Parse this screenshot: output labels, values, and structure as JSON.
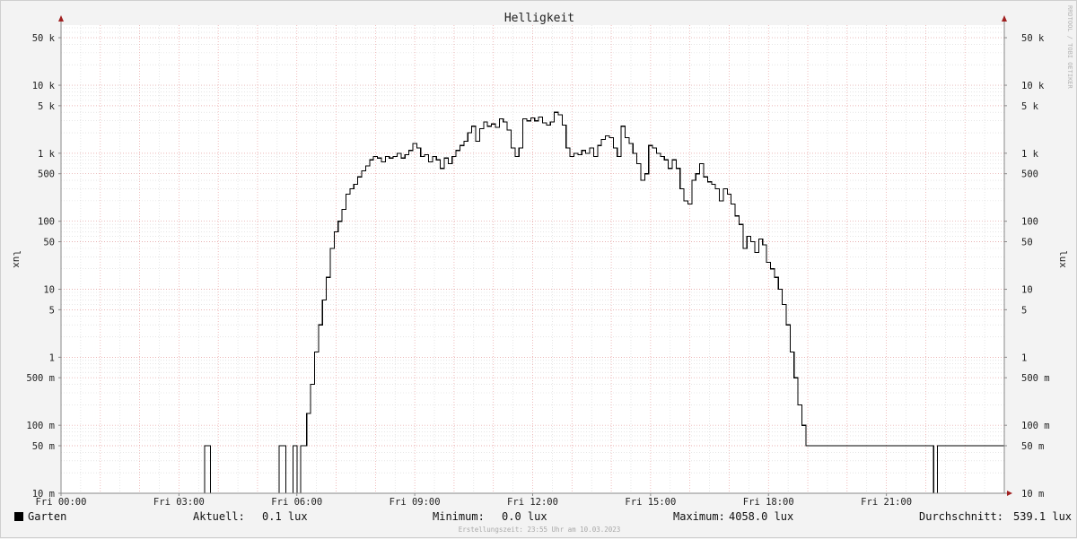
{
  "chart_data": {
    "type": "line",
    "title": "Helligkeit",
    "ylabel": "lux",
    "yscale": "log",
    "ylim": [
      0.01,
      80000
    ],
    "xlim_hours": [
      0,
      24
    ],
    "grid": true,
    "watermark": "RRDTOOL / TOBI OETIKER",
    "x_ticks": [
      {
        "h": 0,
        "label": "Fri 00:00"
      },
      {
        "h": 3,
        "label": "Fri 03:00"
      },
      {
        "h": 6,
        "label": "Fri 06:00"
      },
      {
        "h": 9,
        "label": "Fri 09:00"
      },
      {
        "h": 12,
        "label": "Fri 12:00"
      },
      {
        "h": 15,
        "label": "Fri 15:00"
      },
      {
        "h": 18,
        "label": "Fri 18:00"
      },
      {
        "h": 21,
        "label": "Fri 21:00"
      }
    ],
    "y_ticks": [
      {
        "v": 50000,
        "label": "50 k"
      },
      {
        "v": 10000,
        "label": "10 k"
      },
      {
        "v": 5000,
        "label": "5 k"
      },
      {
        "v": 1000,
        "label": "1 k"
      },
      {
        "v": 500,
        "label": "500"
      },
      {
        "v": 100,
        "label": "100"
      },
      {
        "v": 50,
        "label": "50"
      },
      {
        "v": 10,
        "label": "10"
      },
      {
        "v": 5,
        "label": "5"
      },
      {
        "v": 1,
        "label": "1"
      },
      {
        "v": 0.5,
        "label": "500 m"
      },
      {
        "v": 0.1,
        "label": "100 m"
      },
      {
        "v": 0.05,
        "label": "50 m"
      },
      {
        "v": 0.01,
        "label": "10 m"
      }
    ],
    "series": [
      {
        "name": "Garten",
        "color": "#000000",
        "points": [
          [
            0,
            0.01
          ],
          [
            3.65,
            0.01
          ],
          [
            3.65,
            0.05
          ],
          [
            3.8,
            0.05
          ],
          [
            3.8,
            0.01
          ],
          [
            5.55,
            0.01
          ],
          [
            5.55,
            0.05
          ],
          [
            5.72,
            0.05
          ],
          [
            5.72,
            0.01
          ],
          [
            5.9,
            0.01
          ],
          [
            5.9,
            0.05
          ],
          [
            6.0,
            0.05
          ],
          [
            6.0,
            0.01
          ],
          [
            6.1,
            0.01
          ],
          [
            6.1,
            0.05
          ],
          [
            6.25,
            0.05
          ],
          [
            6.25,
            0.15
          ],
          [
            6.35,
            0.4
          ],
          [
            6.45,
            1.2
          ],
          [
            6.55,
            3
          ],
          [
            6.65,
            7
          ],
          [
            6.75,
            15
          ],
          [
            6.85,
            40
          ],
          [
            6.95,
            70
          ],
          [
            7.05,
            100
          ],
          [
            7.15,
            150
          ],
          [
            7.25,
            250
          ],
          [
            7.35,
            300
          ],
          [
            7.45,
            350
          ],
          [
            7.55,
            450
          ],
          [
            7.65,
            550
          ],
          [
            7.75,
            650
          ],
          [
            7.85,
            800
          ],
          [
            7.95,
            900
          ],
          [
            8.05,
            850
          ],
          [
            8.15,
            750
          ],
          [
            8.25,
            900
          ],
          [
            8.35,
            850
          ],
          [
            8.45,
            900
          ],
          [
            8.55,
            1000
          ],
          [
            8.65,
            850
          ],
          [
            8.75,
            950
          ],
          [
            8.85,
            1100
          ],
          [
            8.95,
            1400
          ],
          [
            9.05,
            1200
          ],
          [
            9.15,
            900
          ],
          [
            9.25,
            950
          ],
          [
            9.35,
            750
          ],
          [
            9.45,
            900
          ],
          [
            9.55,
            800
          ],
          [
            9.65,
            600
          ],
          [
            9.75,
            850
          ],
          [
            9.85,
            700
          ],
          [
            9.95,
            900
          ],
          [
            10.05,
            1100
          ],
          [
            10.15,
            1300
          ],
          [
            10.25,
            1500
          ],
          [
            10.35,
            2000
          ],
          [
            10.45,
            2500
          ],
          [
            10.55,
            1500
          ],
          [
            10.65,
            2300
          ],
          [
            10.75,
            2900
          ],
          [
            10.85,
            2500
          ],
          [
            10.95,
            2700
          ],
          [
            11.05,
            2400
          ],
          [
            11.15,
            3200
          ],
          [
            11.25,
            2900
          ],
          [
            11.35,
            2200
          ],
          [
            11.45,
            1200
          ],
          [
            11.55,
            900
          ],
          [
            11.65,
            1200
          ],
          [
            11.75,
            3200
          ],
          [
            11.85,
            3000
          ],
          [
            11.95,
            3300
          ],
          [
            12.05,
            3000
          ],
          [
            12.15,
            3400
          ],
          [
            12.25,
            2800
          ],
          [
            12.35,
            2600
          ],
          [
            12.45,
            2900
          ],
          [
            12.55,
            4000
          ],
          [
            12.65,
            3700
          ],
          [
            12.75,
            2600
          ],
          [
            12.85,
            1200
          ],
          [
            12.95,
            900
          ],
          [
            13.05,
            1000
          ],
          [
            13.15,
            950
          ],
          [
            13.25,
            1100
          ],
          [
            13.35,
            1000
          ],
          [
            13.45,
            1200
          ],
          [
            13.55,
            900
          ],
          [
            13.65,
            1300
          ],
          [
            13.75,
            1600
          ],
          [
            13.85,
            1800
          ],
          [
            13.95,
            1700
          ],
          [
            14.05,
            1200
          ],
          [
            14.15,
            900
          ],
          [
            14.25,
            2500
          ],
          [
            14.35,
            1700
          ],
          [
            14.45,
            1400
          ],
          [
            14.55,
            1000
          ],
          [
            14.65,
            700
          ],
          [
            14.75,
            400
          ],
          [
            14.85,
            500
          ],
          [
            14.95,
            1300
          ],
          [
            15.05,
            1200
          ],
          [
            15.15,
            1000
          ],
          [
            15.25,
            900
          ],
          [
            15.35,
            800
          ],
          [
            15.45,
            600
          ],
          [
            15.55,
            800
          ],
          [
            15.65,
            600
          ],
          [
            15.75,
            300
          ],
          [
            15.85,
            200
          ],
          [
            15.95,
            180
          ],
          [
            16.05,
            400
          ],
          [
            16.15,
            500
          ],
          [
            16.25,
            700
          ],
          [
            16.35,
            450
          ],
          [
            16.45,
            380
          ],
          [
            16.55,
            350
          ],
          [
            16.65,
            300
          ],
          [
            16.75,
            200
          ],
          [
            16.85,
            300
          ],
          [
            16.95,
            250
          ],
          [
            17.05,
            180
          ],
          [
            17.15,
            120
          ],
          [
            17.25,
            90
          ],
          [
            17.35,
            40
          ],
          [
            17.45,
            60
          ],
          [
            17.55,
            50
          ],
          [
            17.65,
            35
          ],
          [
            17.75,
            55
          ],
          [
            17.85,
            45
          ],
          [
            17.95,
            25
          ],
          [
            18.05,
            20
          ],
          [
            18.15,
            15
          ],
          [
            18.25,
            10
          ],
          [
            18.35,
            6
          ],
          [
            18.45,
            3
          ],
          [
            18.55,
            1.2
          ],
          [
            18.65,
            0.5
          ],
          [
            18.75,
            0.2
          ],
          [
            18.85,
            0.1
          ],
          [
            18.95,
            0.05
          ],
          [
            22.2,
            0.05
          ],
          [
            22.2,
            0.01
          ],
          [
            22.3,
            0.01
          ],
          [
            22.3,
            0.05
          ],
          [
            24,
            0.05
          ]
        ]
      }
    ],
    "legend": {
      "swatch_color": "#000000",
      "name": "Garten",
      "current_label": "Aktuell:",
      "current_value": "0.1 lux",
      "min_label": "Minimum:",
      "min_value": "0.0 lux",
      "max_label": "Maximum:",
      "max_value": "4058.0 lux",
      "avg_label": "Durchschnitt:",
      "avg_value": "539.1 lux"
    },
    "footer": "Erstellungszeit: 23:55 Uhr am 10.03.2023"
  }
}
